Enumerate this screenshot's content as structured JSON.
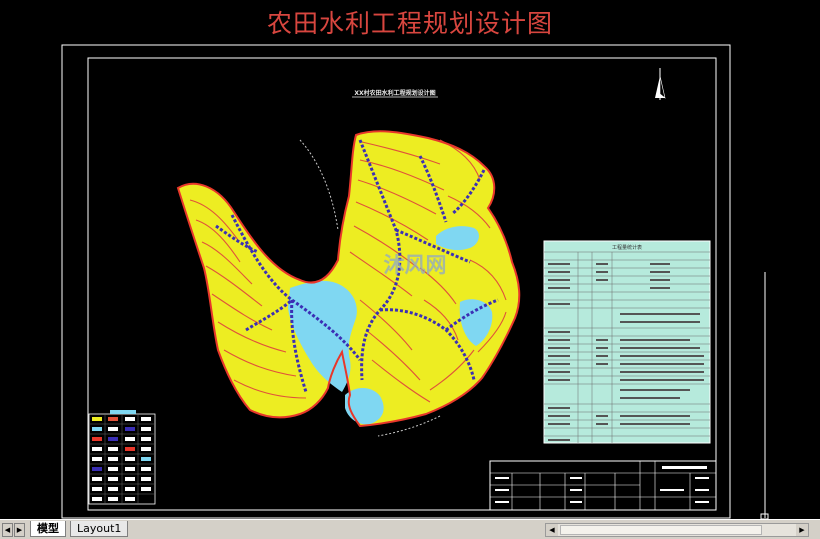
{
  "page_title": "农田水利工程规划设计图",
  "drawing": {
    "inner_title": "XX村农田水利工程规划设计图",
    "table_title": "工程量统计表",
    "watermark": "沐风网"
  },
  "tabs": {
    "model": "模型",
    "layout": "Layout1"
  },
  "colors": {
    "background": "#000000",
    "title": "#d8463f",
    "terrain": "#eded22",
    "canal": "#3b2fb5",
    "water": "#7fd7f2",
    "table": "#b6eadc",
    "contour": "#e0523a"
  },
  "icons": [
    "north-arrow-icon",
    "scroll-left-icon",
    "scroll-right-icon",
    "tab-first-icon",
    "tab-prev-icon",
    "tab-next-icon",
    "tab-last-icon"
  ]
}
